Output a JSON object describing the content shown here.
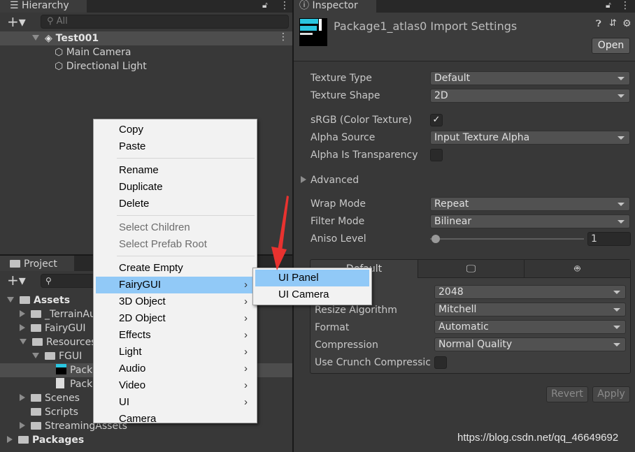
{
  "hierarchy": {
    "tab": "Hierarchy",
    "search_placeholder": "All",
    "scene": "Test001",
    "items": [
      "Main Camera",
      "Directional Light"
    ]
  },
  "project": {
    "tab": "Project",
    "tree": [
      {
        "label": "Assets",
        "depth": 0,
        "state": "open",
        "bold": true
      },
      {
        "label": "_TerrainAu",
        "depth": 1,
        "state": "closed"
      },
      {
        "label": "FairyGUI",
        "depth": 1,
        "state": "closed"
      },
      {
        "label": "Resources",
        "depth": 1,
        "state": "open"
      },
      {
        "label": "FGUI",
        "depth": 2,
        "state": "open"
      },
      {
        "label": "Pack",
        "depth": 3,
        "state": "atlas",
        "selected": true
      },
      {
        "label": "Pack",
        "depth": 3,
        "state": "file"
      },
      {
        "label": "Scenes",
        "depth": 1,
        "state": "closed"
      },
      {
        "label": "Scripts",
        "depth": 1,
        "state": "none"
      },
      {
        "label": "StreamingAssets",
        "depth": 1,
        "state": "closed"
      },
      {
        "label": "Packages",
        "depth": 0,
        "state": "closed",
        "bold": true
      }
    ]
  },
  "context_menu": {
    "items": [
      {
        "label": "Copy"
      },
      {
        "label": "Paste"
      },
      {
        "sep": true
      },
      {
        "label": "Rename"
      },
      {
        "label": "Duplicate"
      },
      {
        "label": "Delete"
      },
      {
        "sep": true
      },
      {
        "label": "Select Children",
        "disabled": true
      },
      {
        "label": "Select Prefab Root",
        "disabled": true
      },
      {
        "sep": true
      },
      {
        "label": "Create Empty"
      },
      {
        "label": "FairyGUI",
        "submenu": true,
        "highlighted": true
      },
      {
        "label": "3D Object",
        "submenu": true
      },
      {
        "label": "2D Object",
        "submenu": true
      },
      {
        "label": "Effects",
        "submenu": true
      },
      {
        "label": "Light",
        "submenu": true
      },
      {
        "label": "Audio",
        "submenu": true
      },
      {
        "label": "Video",
        "submenu": true
      },
      {
        "label": "UI",
        "submenu": true
      },
      {
        "label": "Camera"
      }
    ],
    "submenu": [
      {
        "label": "UI Panel",
        "highlighted": true
      },
      {
        "label": "UI Camera"
      }
    ]
  },
  "inspector": {
    "tab": "Inspector",
    "title": "Package1_atlas0 Import Settings",
    "open_button": "Open",
    "texture_type": {
      "label": "Texture Type",
      "value": "Default"
    },
    "texture_shape": {
      "label": "Texture Shape",
      "value": "2D"
    },
    "srgb": {
      "label": "sRGB (Color Texture)",
      "checked": true,
      "mark": "✓"
    },
    "alpha_source": {
      "label": "Alpha Source",
      "value": "Input Texture Alpha"
    },
    "alpha_transparency": {
      "label": "Alpha Is Transparency",
      "checked": false
    },
    "advanced": "Advanced",
    "wrap_mode": {
      "label": "Wrap Mode",
      "value": "Repeat"
    },
    "filter_mode": {
      "label": "Filter Mode",
      "value": "Bilinear"
    },
    "aniso": {
      "label": "Aniso Level",
      "value": "1",
      "slider_fraction": 0.0
    },
    "platform_tabs": [
      "Default",
      "monitor-icon",
      "android-icon"
    ],
    "max_size": {
      "value": "2048"
    },
    "resize": {
      "label": "Resize Algorithm",
      "value": "Mitchell"
    },
    "format": {
      "label": "Format",
      "value": "Automatic"
    },
    "compression": {
      "label": "Compression",
      "value": "Normal Quality"
    },
    "crunch": {
      "label": "Use Crunch Compressic",
      "checked": false
    },
    "revert": "Revert",
    "apply": "Apply"
  },
  "watermark": "https://blog.csdn.net/qq_46649692",
  "colors": {
    "menu_highlight": "#91c9f7",
    "arrow": "#e8322f"
  }
}
